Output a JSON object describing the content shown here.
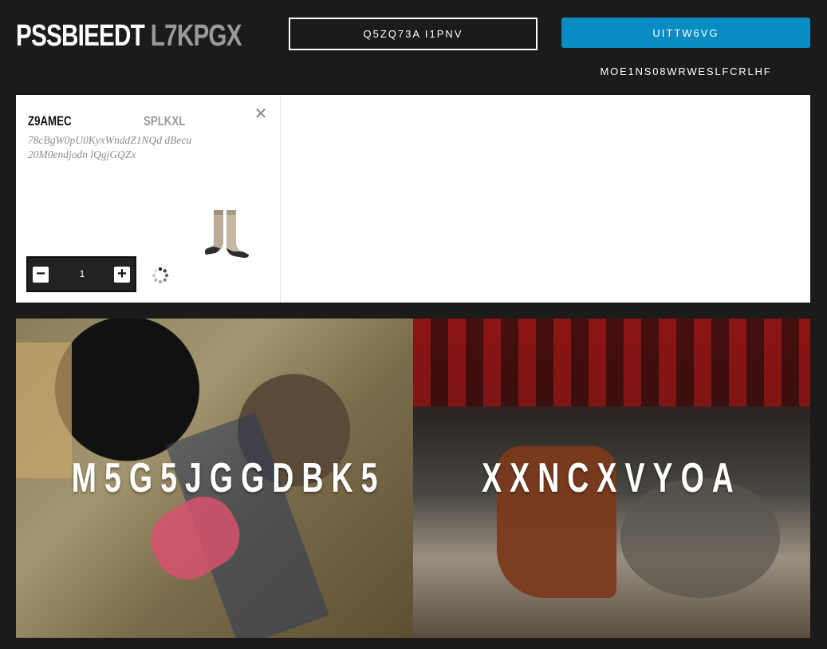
{
  "header": {
    "brand_primary": "PSSBIEEDT",
    "brand_secondary": "L7KPGX",
    "outline_button": "Q5ZQ73A I1PNV",
    "primary_button": "UITTW6VG",
    "link_text": "MOE1NS08WRWESLFCRLHF"
  },
  "cart_item": {
    "name": "Z9AMEC",
    "variant": "SPLKXL",
    "description": "78cBgW0pU0KyxWnddZ1NQd dBecu20M0endjodn lQgjGQZx",
    "quantity": "1",
    "minus_label": "−",
    "plus_label": "+",
    "close_label": "✕"
  },
  "promos": [
    {
      "title": "M5G5JGGDBK5"
    },
    {
      "title": "XXNCXVYOA"
    }
  ],
  "colors": {
    "accent": "#0a8bc2",
    "background": "#1b1b1b"
  },
  "icons": [
    "close-icon",
    "minus-icon",
    "plus-icon",
    "loading-spinner-icon",
    "sock-product-image"
  ]
}
